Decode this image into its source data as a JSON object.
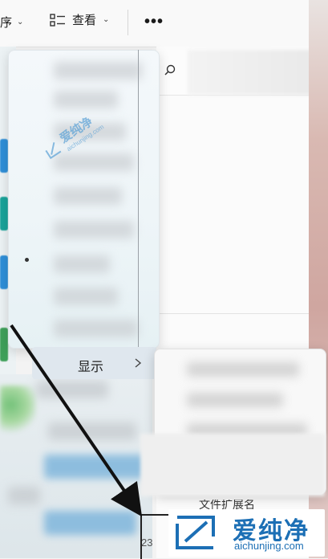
{
  "toolbar": {
    "sort_label": "序",
    "view_label": "查看",
    "more_label": "•••"
  },
  "context_menu": {
    "show_item_label": "显示"
  },
  "submenu": {
    "partial_item_text": "文件扩展名",
    "partial_number": "23"
  },
  "watermark": {
    "small_cn": "爱纯净",
    "small_en": "aichunjing.com",
    "big_cn": "爱纯净",
    "big_en": "aichunjing.com"
  },
  "colors": {
    "accent_blue": "#1c6fb5",
    "arrow": "#111111"
  },
  "icons": {
    "view": "list-view-icon",
    "search": "search-icon",
    "chevron": "chevron-right-icon",
    "watermark_logo": "aichunjing-logo-icon"
  }
}
